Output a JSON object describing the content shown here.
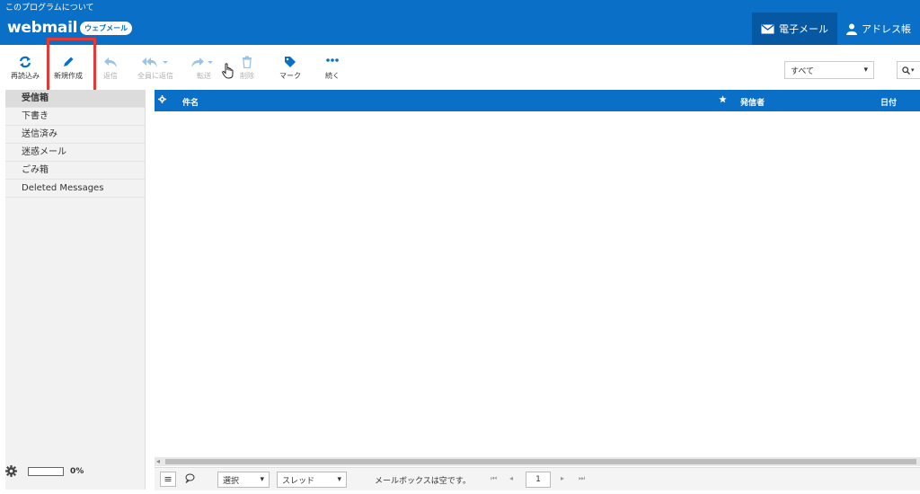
{
  "header": {
    "about_link": "このプログラムについて",
    "logo_text": "webmail",
    "logo_badge": "ウェブメール",
    "nav": [
      {
        "label": "電子メール",
        "icon": "envelope-icon"
      },
      {
        "label": "アドレス帳",
        "icon": "person-icon"
      }
    ]
  },
  "toolbar": {
    "buttons": [
      {
        "label": "再読込み",
        "icon": "refresh-icon"
      },
      {
        "label": "新規作成",
        "icon": "pencil-icon"
      },
      {
        "label": "返信",
        "icon": "reply-icon"
      },
      {
        "label": "全員に返信",
        "icon": "reply-all-icon"
      },
      {
        "label": "転送",
        "icon": "forward-icon"
      },
      {
        "label": "削除",
        "icon": "trash-icon"
      },
      {
        "label": "マーク",
        "icon": "tag-icon"
      },
      {
        "label": "続く",
        "icon": "more-dots-icon"
      }
    ],
    "filter_value": "すべて"
  },
  "sidebar": {
    "folders": [
      "受信箱",
      "下書き",
      "送信済み",
      "迷惑メール",
      "ごみ箱",
      "Deleted Messages"
    ],
    "quota_percent": "0%"
  },
  "list": {
    "columns": {
      "subject": "件名",
      "from": "発信者",
      "date": "日付"
    }
  },
  "statusbar": {
    "select_label": "選択",
    "thread_label": "スレッド",
    "status_text": "メールボックスは空です。",
    "page_number": "1"
  },
  "colors": {
    "brand_blue": "#0a6fc6",
    "highlight_red": "#e53935"
  }
}
